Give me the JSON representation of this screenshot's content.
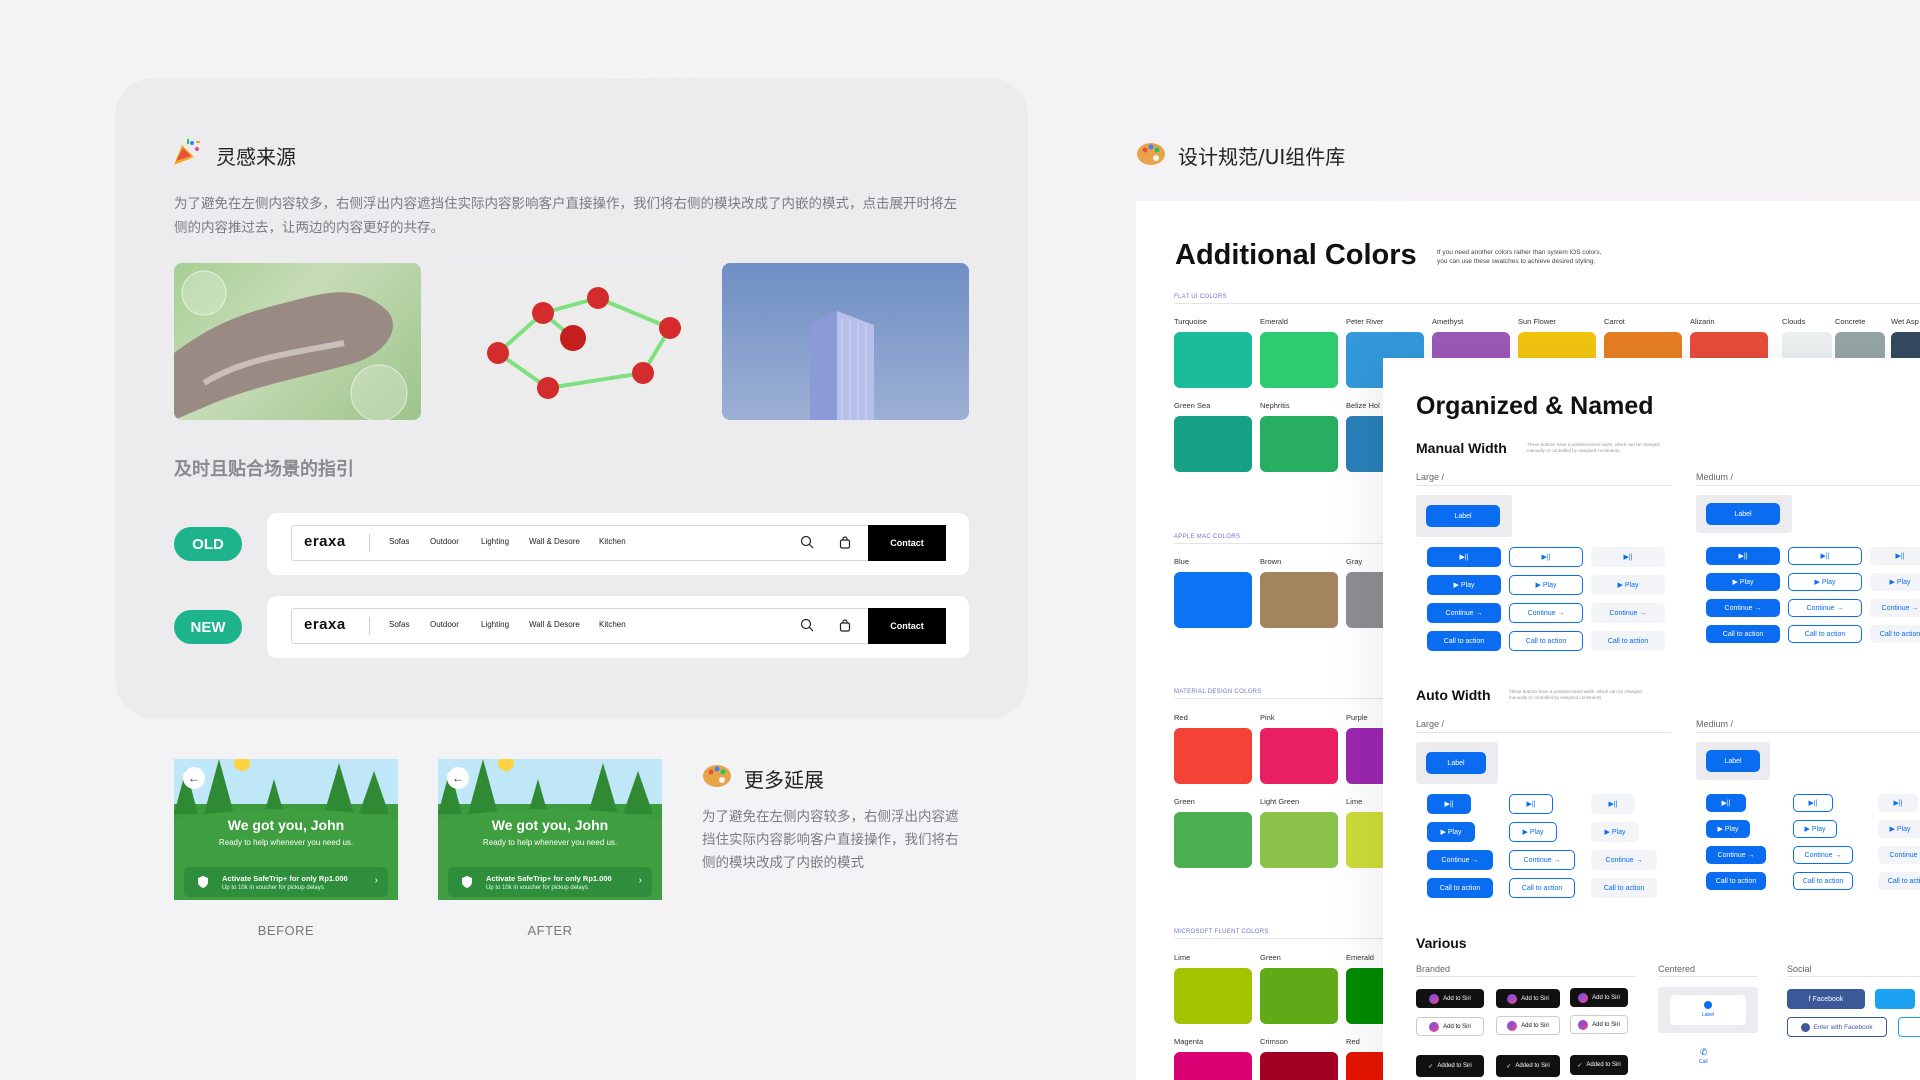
{
  "inspiration": {
    "title": "灵感来源",
    "description": "为了避免在左侧内容较多，右侧浮出内容遮挡住实际内容影响客户直接操作，我们将右侧的模块改成了内嵌的模式，点击展开时将左侧的内容推过去，让两边的内容更好的共存。",
    "subheading": "及时且贴合场景的指引"
  },
  "comparison": {
    "old_label": "OLD",
    "new_label": "NEW",
    "nav": {
      "logo": "eraxa",
      "links": [
        "Sofas",
        "Outdoor",
        "Lighting",
        "Wall & Desore",
        "Kitchen"
      ],
      "contact": "Contact"
    }
  },
  "extension": {
    "title": "更多延展",
    "description": "为了避免在左侧内容较多，右侧浮出内容遮挡住实际内容影响客户直接操作，我们将右侧的模块改成了内嵌的模式"
  },
  "phones": {
    "headline": "We got you, John",
    "subline": "Ready to help whenever you need us.",
    "banner_title": "Activate SafeTrip+ for only Rp1.000",
    "banner_sub": "Up to 10k in voucher for pickup delays.",
    "before_caption": "BEFORE",
    "after_caption": "AFTER"
  },
  "design_system": {
    "title": "设计规范/UI组件库",
    "colors_heading": "Additional Colors",
    "colors_note_1": "If you need another colors rather than system iOS colors,",
    "colors_note_2": "you can use these swatches to achieve desired styling.",
    "sections": [
      "FLAT UI COLORS",
      "APPLE MAC COLORS",
      "MATERIAL DESIGN COLORS",
      "MICROSOFT FLUENT COLORS"
    ],
    "flat_row1": [
      {
        "name": "Turquoise",
        "color": "#1abc9c"
      },
      {
        "name": "Emerald",
        "color": "#2ecc71"
      },
      {
        "name": "Peter River",
        "color": "#3498db"
      },
      {
        "name": "Amethyst",
        "color": "#9b59b6"
      },
      {
        "name": "Sun Flower",
        "color": "#f1c40f"
      },
      {
        "name": "Carrot",
        "color": "#e67e22"
      },
      {
        "name": "Alizarin",
        "color": "#e74c3c"
      },
      {
        "name": "Clouds",
        "color": "#ecf0f1"
      },
      {
        "name": "Concrete",
        "color": "#95a5a6"
      },
      {
        "name": "Wet Asp",
        "color": "#34495e"
      }
    ],
    "flat_row2": [
      {
        "name": "Green Sea",
        "color": "#16a085"
      },
      {
        "name": "Nephritis",
        "color": "#27ae60"
      },
      {
        "name": "Belize Hol",
        "color": "#2980b9"
      }
    ],
    "apple_row": [
      {
        "name": "Blue",
        "color": "#0a74f5"
      },
      {
        "name": "Brown",
        "color": "#a2845e"
      },
      {
        "name": "Gray",
        "color": "#8e8e93"
      }
    ],
    "material_row1": [
      {
        "name": "Red",
        "color": "#f44336"
      },
      {
        "name": "Pink",
        "color": "#e91e63"
      },
      {
        "name": "Purple",
        "color": "#9c27b0"
      }
    ],
    "material_row2": [
      {
        "name": "Green",
        "color": "#4caf50"
      },
      {
        "name": "Light Green",
        "color": "#8bc34a"
      },
      {
        "name": "Lime",
        "color": "#cddc39"
      }
    ],
    "fluent_row1": [
      {
        "name": "Lime",
        "color": "#a4c400"
      },
      {
        "name": "Green",
        "color": "#60a917"
      },
      {
        "name": "Emerald",
        "color": "#008a00"
      }
    ],
    "fluent_row2": [
      {
        "name": "Magenta",
        "color": "#d80073"
      },
      {
        "name": "Crimson",
        "color": "#a20025"
      },
      {
        "name": "Red",
        "color": "#e51400"
      }
    ]
  },
  "components": {
    "heading": "Organized & Named",
    "manual_width": "Manual Width",
    "manual_note": "These buttons have a predetermined width, which can be changed manually or controlled by assigned constraints.",
    "auto_width": "Auto Width",
    "auto_note": "These buttons have a predetermined width, which can be changed manually or controlled by assigned constraints.",
    "large": "Large /",
    "medium": "Medium /",
    "label_btn": "Label",
    "play_icon": "▶︎||",
    "play": "▶ Play",
    "continue": "Continue →",
    "cta": "Call to action",
    "various": "Various",
    "branded": "Branded",
    "centered": "Centered",
    "social": "Social",
    "add_to_siri": "Add to Siri",
    "added_to_siri": "Added to Siri",
    "facebook": "f  Facebook",
    "enter_facebook": "Enter with Facebook",
    "center_label": "Label",
    "call": "Call"
  }
}
